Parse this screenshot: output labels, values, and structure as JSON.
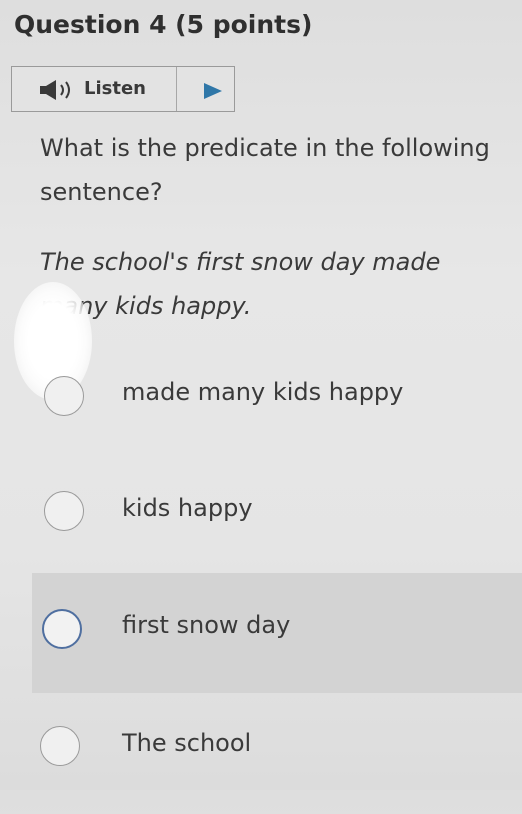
{
  "question": {
    "title": "Question 4 (5 points)"
  },
  "listen": {
    "label": "Listen",
    "speaker_icon": "speaker-icon",
    "play_icon": "play-icon",
    "accent_color": "#2f77a8"
  },
  "prompt": {
    "text": "What is the predicate in the following sentence?"
  },
  "sentence": {
    "text": "The school's first snow day made many kids happy."
  },
  "options": [
    {
      "label": "made many kids happy"
    },
    {
      "label": "kids happy"
    },
    {
      "label": "first snow day"
    },
    {
      "label": "The school"
    }
  ]
}
